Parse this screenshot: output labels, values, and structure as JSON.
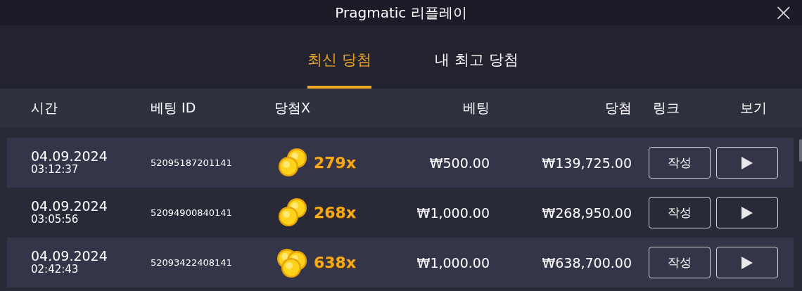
{
  "window": {
    "title": "Pragmatic 리플레이",
    "close": "×"
  },
  "tabs": [
    {
      "label": "최신 당첨",
      "selected": true
    },
    {
      "label": "내 최고 당첨",
      "selected": false
    }
  ],
  "table": {
    "columns": [
      "시간",
      "베팅 ID",
      "당첨X",
      "베팅",
      "당첨",
      "링크",
      "보기"
    ],
    "rows": [
      {
        "date": "04.09.2024",
        "time": "03:12:37",
        "bet_id": "52095187201141",
        "kind": "pair",
        "multiplier": "279x",
        "bet": "₩500.00",
        "win": "₩139,725.00",
        "link": "작성"
      },
      {
        "date": "04.09.2024",
        "time": "03:05:56",
        "bet_id": "52094900840141",
        "kind": "pair",
        "multiplier": "268x",
        "bet": "₩1,000.00",
        "win": "₩268,950.00",
        "link": "작성"
      },
      {
        "date": "04.09.2024",
        "time": "02:42:43",
        "bet_id": "52093422408141",
        "kind": "pile",
        "multiplier": "638x",
        "bet": "₩1,000.00",
        "win": "₩638,700.00",
        "link": "작성"
      }
    ]
  }
}
